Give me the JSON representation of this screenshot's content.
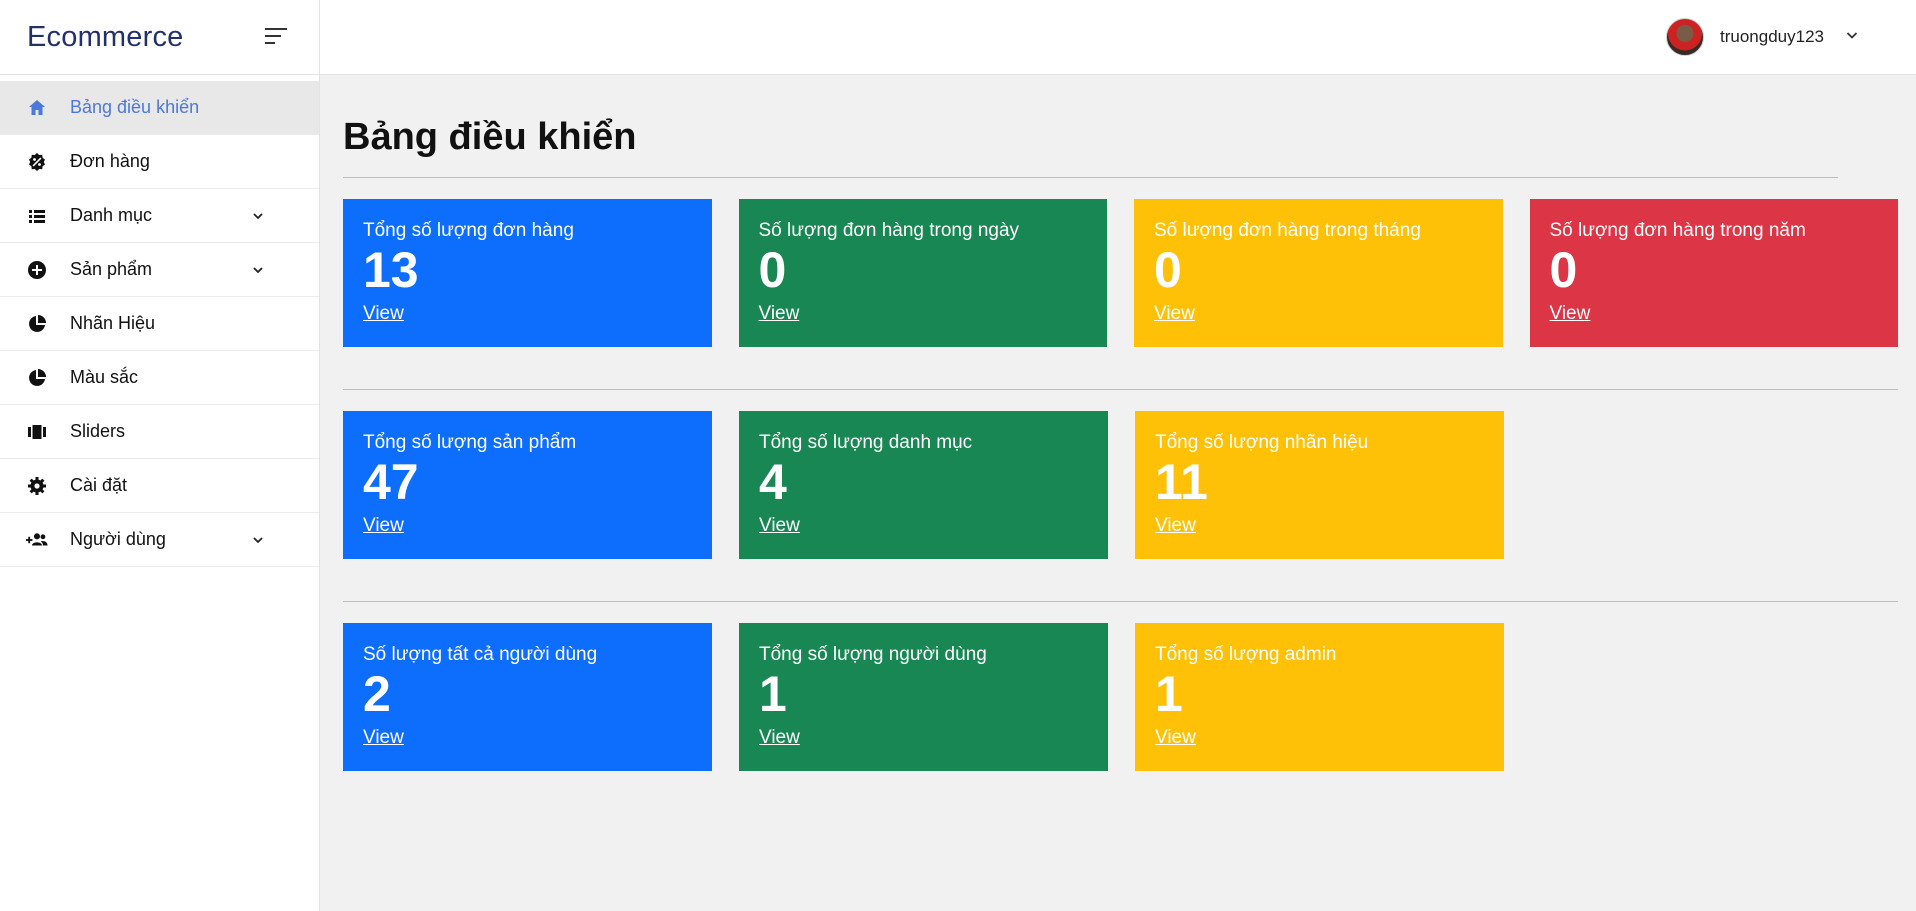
{
  "brand": {
    "title": "Ecommerce"
  },
  "sidebar": {
    "items": [
      {
        "label": "Bảng điều khiển",
        "icon": "home-icon",
        "active": true
      },
      {
        "label": "Đơn hàng",
        "icon": "badge-percent-icon"
      },
      {
        "label": "Danh mục",
        "icon": "list-icon",
        "chevron": true
      },
      {
        "label": "Sản phẩm",
        "icon": "plus-circle-icon",
        "chevron": true
      },
      {
        "label": "Nhãn Hiệu",
        "icon": "pie-chart-icon"
      },
      {
        "label": "Màu sắc",
        "icon": "pie-chart-icon"
      },
      {
        "label": "Sliders",
        "icon": "slides-icon"
      },
      {
        "label": "Cài đặt",
        "icon": "gear-icon"
      },
      {
        "label": "Người dùng",
        "icon": "user-plus-icon",
        "chevron": true
      }
    ]
  },
  "topbar": {
    "username": "truongduy123"
  },
  "main": {
    "title": "Bảng điều khiển",
    "rows": [
      [
        {
          "label": "Tổng số lượng đơn hàng",
          "value": "13",
          "link": "View",
          "color": "#0d6efd"
        },
        {
          "label": "Số lượng đơn hàng trong ngày",
          "value": "0",
          "link": "View",
          "color": "#198754"
        },
        {
          "label": "Số lượng đơn hàng trong tháng",
          "value": "0",
          "link": "View",
          "color": "#ffc107"
        },
        {
          "label": "Số lượng đơn hàng trong năm",
          "value": "0",
          "link": "View",
          "color": "#dc3545"
        }
      ],
      [
        {
          "label": "Tổng số lượng sản phẩm",
          "value": "47",
          "link": "View",
          "color": "#0d6efd"
        },
        {
          "label": "Tổng số lượng danh mục",
          "value": "4",
          "link": "View",
          "color": "#198754"
        },
        {
          "label": "Tổng số lượng nhãn hiệu",
          "value": "11",
          "link": "View",
          "color": "#ffc107"
        }
      ],
      [
        {
          "label": "Số lượng tất cả người dùng",
          "value": "2",
          "link": "View",
          "color": "#0d6efd"
        },
        {
          "label": "Tổng số lượng người dùng",
          "value": "1",
          "link": "View",
          "color": "#198754"
        },
        {
          "label": "Tổng số lượng admin",
          "value": "1",
          "link": "View",
          "color": "#ffc107"
        }
      ]
    ]
  }
}
